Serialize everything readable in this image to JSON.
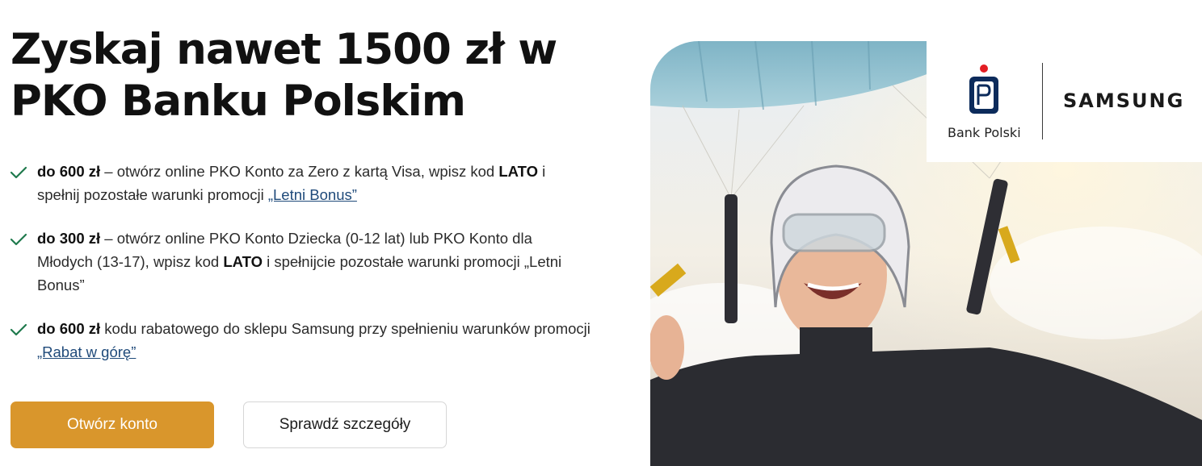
{
  "headline": {
    "line1": "Zyskaj nawet 1500 zł w",
    "line2": "PKO Banku Polskim"
  },
  "benefits": [
    {
      "amount": "do 600 zł",
      "text_a": " – otwórz online PKO Konto za Zero z kartą Visa, wpisz kod ",
      "code": "LATO",
      "text_b": " i spełnij pozostałe warunki promocji ",
      "link": "„Letni Bonus”",
      "text_c": ""
    },
    {
      "amount": "do 300 zł",
      "text_a": " – otwórz online PKO Konto Dziecka (0-12 lat) lub PKO Konto dla Młodych (13-17), wpisz kod ",
      "code": "LATO",
      "text_b": " i spełnijcie pozostałe warunki promocji „Letni Bonus”",
      "link": "",
      "text_c": ""
    },
    {
      "amount": "do 600 zł",
      "text_a": " kodu rabatowego do sklepu Samsung przy spełnieniu warunków promocji ",
      "code": "",
      "text_b": "",
      "link": "„Rabat w górę”",
      "text_c": ""
    }
  ],
  "buttons": {
    "primary": "Otwórz konto",
    "secondary": "Sprawdź szczegóły"
  },
  "logos": {
    "pko_caption": "Bank Polski",
    "samsung": "SAMSUNG"
  },
  "colors": {
    "accent": "#d9962c",
    "check": "#1f7a4d",
    "link": "#1f4a7a",
    "pko_dot": "#e31e24"
  },
  "icons": {
    "check": "check-icon",
    "pko": "pko-logo-icon"
  }
}
